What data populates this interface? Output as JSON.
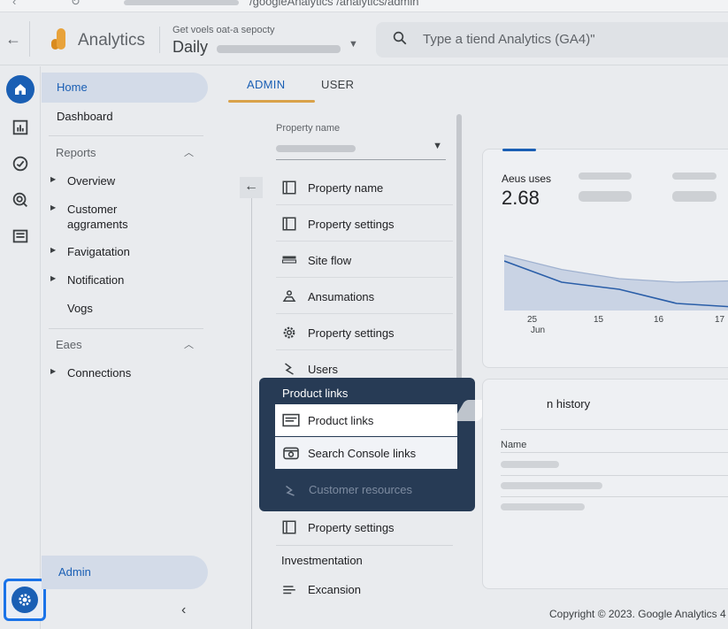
{
  "browser": {
    "url": "/googleAnalytics /analytics/admin"
  },
  "header": {
    "app_title": "Analytics",
    "account_sub": "Get voels oat-a sepocty",
    "account_main": "Daily",
    "search_placeholder": "Type a tiend Analytics (GA4)\""
  },
  "sidenav": {
    "home": "Home",
    "dashboard": "Dashboard",
    "reports_section": "Reports",
    "report_items": [
      "Overview",
      "Customer aggraments",
      "Favigatation",
      "Notification"
    ],
    "vogs": "Vogs",
    "eaes_section": "Eaes",
    "connections": "Connections",
    "admin": "Admin"
  },
  "tabs": {
    "admin": "ADMIN",
    "user": "USER"
  },
  "property": {
    "label": "Property name",
    "rows": [
      "Property name",
      "Property settings",
      "Site flow",
      "Ansumations",
      "Property settings",
      "Users"
    ],
    "after_popup_row": "Property settings",
    "investment_section": "Investmentation",
    "expansion_row": "Excansion"
  },
  "popup": {
    "title": "Product links",
    "items": [
      "Product links",
      "Search Console links"
    ],
    "dim_item": "Customer resources"
  },
  "card1": {
    "metric_label": "Aeus uses",
    "metric_value": "2.68"
  },
  "chart_data": {
    "type": "area",
    "x_ticks": [
      "25",
      "15",
      "16",
      "17"
    ],
    "x_sub": "Jun",
    "series": [
      {
        "values": [
          0.78,
          0.58,
          0.45,
          0.4,
          0.42
        ]
      },
      {
        "values": [
          0.7,
          0.4,
          0.3,
          0.1,
          0.05
        ]
      }
    ]
  },
  "card2": {
    "title": "n history",
    "col_name": "Name"
  },
  "footer": "Copyright © 2023. Google Analytics 4",
  "colors": {
    "accent": "#1a5fb4",
    "popup_bg": "#273b55",
    "tab_underline": "#d9a24a"
  }
}
